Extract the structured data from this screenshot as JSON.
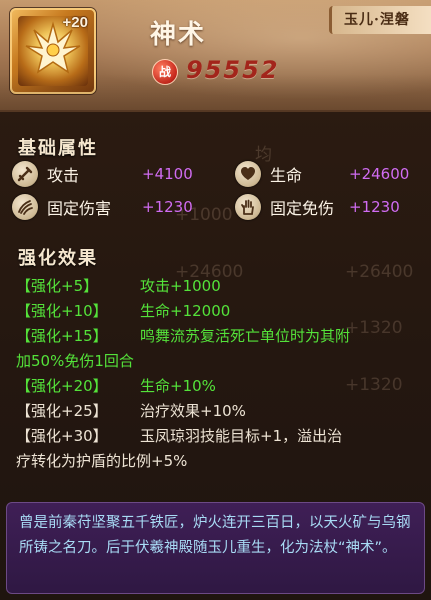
{
  "header": {
    "refine_level": "+20",
    "weapon_name": "神术",
    "owner_badge": "玉儿·涅磐",
    "power_badge": "战",
    "power_value": "95552"
  },
  "base_attributes": {
    "title": "基础属性",
    "items": [
      {
        "icon": "sword-icon",
        "label": "攻击",
        "value": "+4100"
      },
      {
        "icon": "heart-icon",
        "label": "生命",
        "value": "+24600"
      },
      {
        "icon": "claw-icon",
        "label": "固定伤害",
        "value": "+1230"
      },
      {
        "icon": "palm-icon",
        "label": "固定免伤",
        "value": "+1230"
      }
    ]
  },
  "enhancements": {
    "title": "强化效果",
    "items": [
      {
        "level": "【强化+5】",
        "effect": "攻击+1000",
        "unlocked": true
      },
      {
        "level": "【强化+10】",
        "effect": "生命+12000",
        "unlocked": true
      },
      {
        "level": "【强化+15】",
        "effect": "鸣舞流苏复活死亡单位时为其附",
        "continuation": "加50%免伤1回合",
        "unlocked": true
      },
      {
        "level": "【强化+20】",
        "effect": "生命+10%",
        "unlocked": true
      },
      {
        "level": "【强化+25】",
        "effect": "治疗效果+10%",
        "unlocked": false
      },
      {
        "level": "【强化+30】",
        "effect": "玉凤琼羽技能目标+1，溢出治",
        "continuation": "疗转化为护盾的比例+5%",
        "unlocked": false
      }
    ]
  },
  "lore": {
    "text": "曾是前秦苻坚聚五千铁匠，炉火连开三百日，以天火矿与乌钢所铸之名刀。后于伏羲神殿随玉儿重生，化为法杖“神术”。"
  },
  "colors": {
    "unlocked": "#54e23a",
    "locked": "#ede3d4",
    "attr_value": "#d06cf2",
    "power_value": "#a3251b",
    "lore_text": "#a8dbf5"
  }
}
